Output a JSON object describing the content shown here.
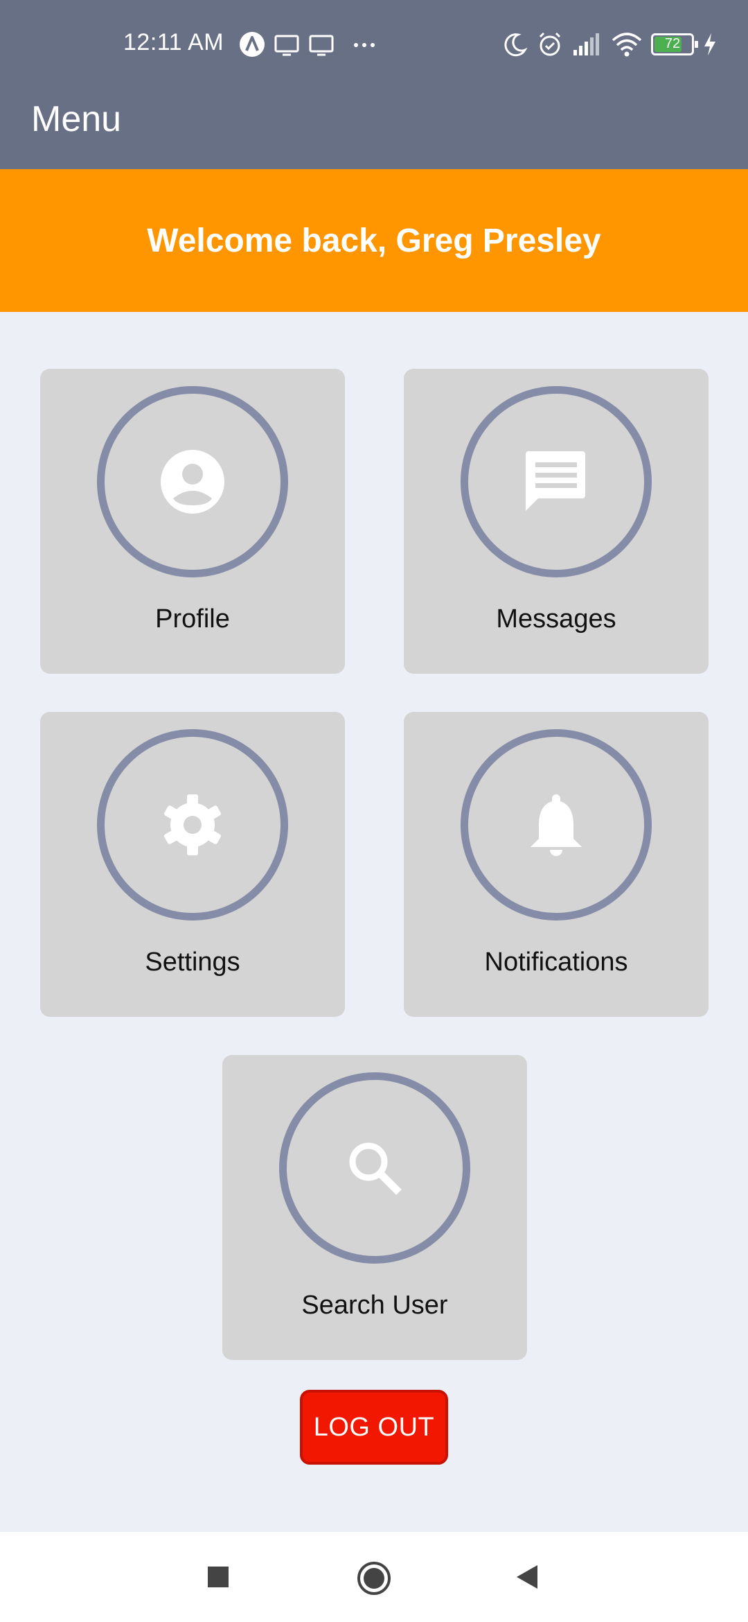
{
  "status_bar": {
    "time": "12:11 AM",
    "battery_level": "72",
    "icons": [
      "app-a-icon",
      "cast-icon",
      "cast-icon",
      "more-dots-icon",
      "moon-icon",
      "alarm-icon",
      "signal-icon",
      "wifi-icon",
      "battery-icon",
      "charging-icon"
    ]
  },
  "app_bar": {
    "title": "Menu"
  },
  "welcome": {
    "text": "Welcome back, Greg Presley"
  },
  "tiles": [
    {
      "label": "Profile",
      "icon": "account-circle-icon"
    },
    {
      "label": "Messages",
      "icon": "message-icon"
    },
    {
      "label": "Settings",
      "icon": "gear-icon"
    },
    {
      "label": "Notifications",
      "icon": "bell-icon"
    },
    {
      "label": "Search User",
      "icon": "search-icon"
    }
  ],
  "logout": {
    "label": "LOG OUT"
  },
  "nav_bar": {
    "buttons": [
      "recents-icon",
      "home-icon",
      "back-icon"
    ]
  },
  "colors": {
    "header": "#687086",
    "banner": "#ff9600",
    "background": "#edeff7",
    "tile": "#d4d4d4",
    "ring": "#858ca7",
    "logout": "#f11700"
  }
}
